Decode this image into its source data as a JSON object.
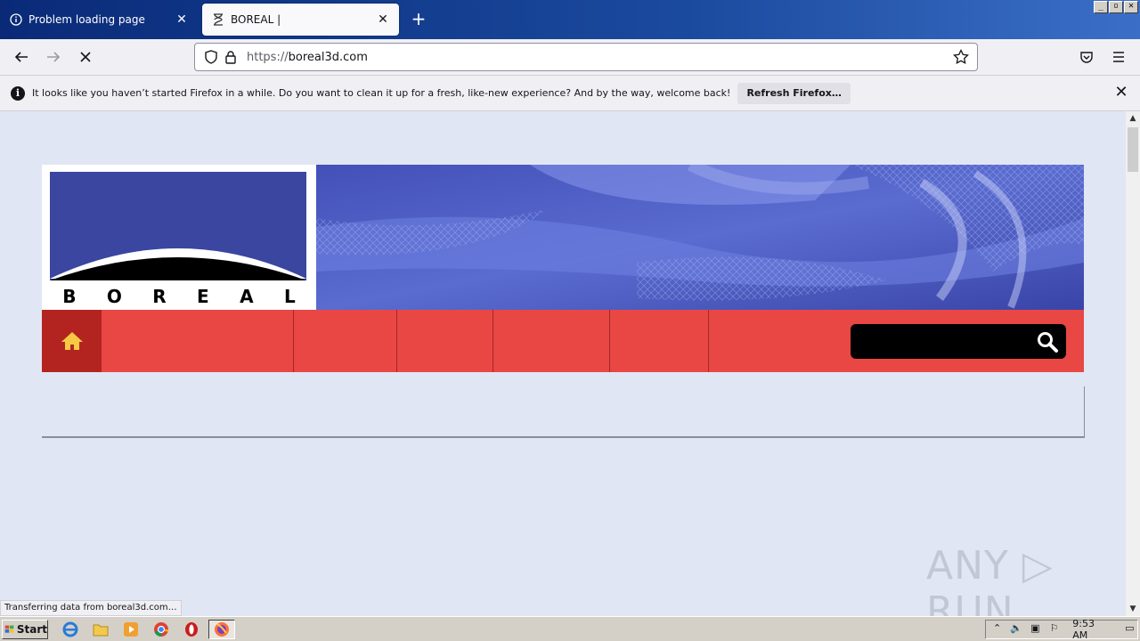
{
  "window": {
    "controls": [
      "_",
      "▫",
      "✕"
    ]
  },
  "tabs": [
    {
      "title": "Problem loading page",
      "icon": "info-icon",
      "active": false
    },
    {
      "title": "BOREAL |",
      "icon": "hourglass-icon",
      "active": true
    }
  ],
  "navbar": {
    "url_protocol": "https://",
    "url_host": "boreal3d.com"
  },
  "notification": {
    "message": "It looks like you haven’t started Firefox in a while. Do you want to clean it up for a fresh, like-new experience? And by the way, welcome back!",
    "button_label": "Refresh Firefox…"
  },
  "page": {
    "logo_letters": [
      "B",
      "O",
      "R",
      "E",
      "A",
      "L"
    ],
    "search_placeholder": "",
    "watermark": "ANY ▷ RUN"
  },
  "status": {
    "text": "Transferring data from boreal3d.com…"
  },
  "taskbar": {
    "start_label": "Start",
    "clock": "9:53 AM"
  },
  "colors": {
    "menu_red": "#e94744",
    "home_red": "#b32421",
    "logo_blue": "#3a46a0",
    "home_icon": "#f6c943"
  }
}
